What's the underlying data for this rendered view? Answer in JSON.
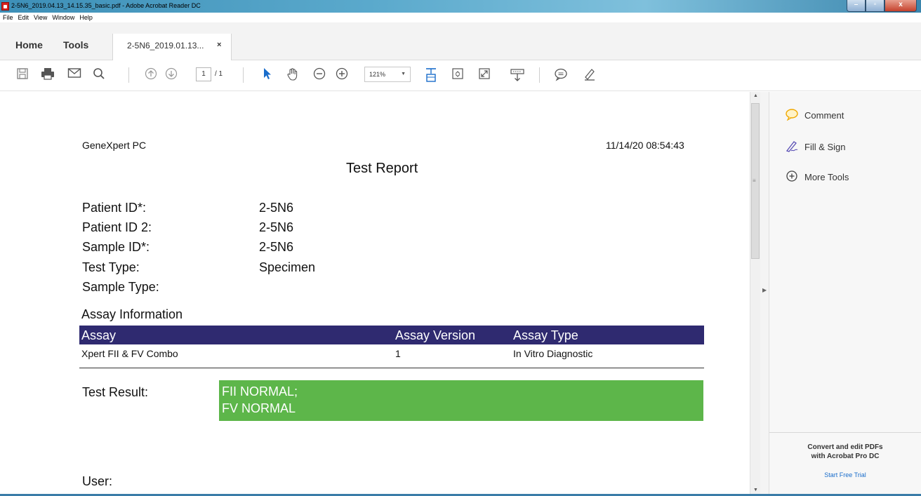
{
  "window": {
    "title": "2-5N6_2019.04.13_14.15.35_basic.pdf - Adobe Acrobat Reader DC",
    "min_icon": "minimize-icon",
    "max_icon": "maximize-icon",
    "close_icon": "close-icon"
  },
  "menu": [
    "File",
    "Edit",
    "View",
    "Window",
    "Help"
  ],
  "tabs": {
    "home": "Home",
    "tools": "Tools",
    "document": "2-5N6_2019.01.13...",
    "close": "×"
  },
  "toolbar": {
    "page_current": "1",
    "page_total": "/ 1",
    "zoom": "121%"
  },
  "document": {
    "header_left": "GeneXpert PC",
    "header_right": "11/14/20 08:54:43",
    "title": "Test Report",
    "fields": [
      {
        "label": "Patient ID*:",
        "value": "2-5N6"
      },
      {
        "label": "Patient ID 2:",
        "value": "2-5N6"
      },
      {
        "label": "Sample ID*:",
        "value": "2-5N6"
      },
      {
        "label": "Test Type:",
        "value": "Specimen"
      },
      {
        "label": "Sample Type:",
        "value": ""
      }
    ],
    "assay_section_title": "Assay Information",
    "assay_columns": [
      "Assay",
      "Assay Version",
      "Assay Type"
    ],
    "assay_row": [
      "Xpert FII & FV Combo",
      "1",
      "In Vitro Diagnostic"
    ],
    "result_label": "Test Result:",
    "result_lines": [
      "FII NORMAL;",
      "FV NORMAL"
    ],
    "user_label": "User:",
    "colors": {
      "assay_header": "#2f2a70",
      "result_box": "#5db64a"
    }
  },
  "right_pane": {
    "items": [
      {
        "label": "Comment",
        "icon": "comment-icon"
      },
      {
        "label": "Fill & Sign",
        "icon": "fill-sign-icon"
      },
      {
        "label": "More Tools",
        "icon": "add-circle-icon"
      }
    ],
    "promo_line1": "Convert and edit PDFs",
    "promo_line2": "with Acrobat Pro DC",
    "promo_link": "Start Free Trial"
  }
}
